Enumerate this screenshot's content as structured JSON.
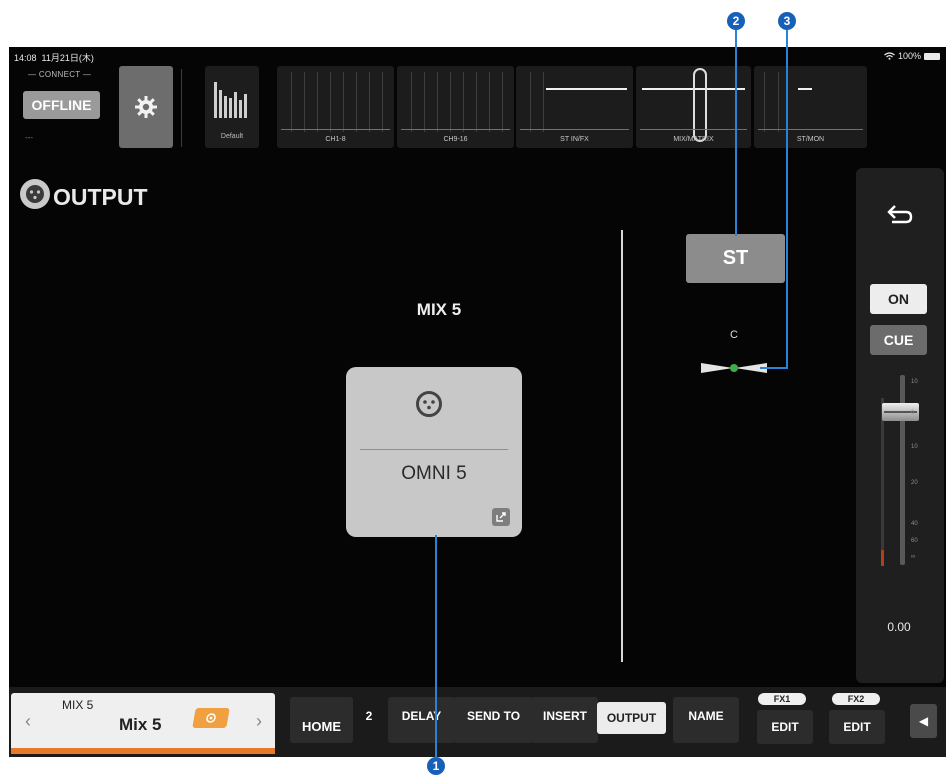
{
  "status_bar": {
    "time": "14:08",
    "date": "11月21日(木)",
    "battery": "100%"
  },
  "connect": {
    "caption": "— CONNECT —",
    "offline_label": "OFFLINE",
    "sub_text": "---"
  },
  "scene": {
    "label": "Default"
  },
  "banks": [
    {
      "label": "CH1-8"
    },
    {
      "label": "CH9-16"
    },
    {
      "label": "ST IN/FX"
    },
    {
      "label": "MIX/MATRIX"
    },
    {
      "label": "ST/MON"
    }
  ],
  "page": {
    "title": "OUTPUT",
    "mix_title": "MIX 5",
    "patch_label": "OMNI 5"
  },
  "st_button": {
    "label": "ST"
  },
  "pan": {
    "label": "C",
    "value": 0
  },
  "strip": {
    "on_label": "ON",
    "cue_label": "CUE",
    "fader_value": "0.00",
    "fader_level_db": 0,
    "scale": [
      "10",
      "0",
      "10",
      "20",
      "40",
      "60",
      "∞"
    ]
  },
  "bottom_bar": {
    "channel_top_name": "MIX 5",
    "channel_name": "Mix 5",
    "tabs": {
      "home": "HOME",
      "partial": "2",
      "delay": "DELAY",
      "send_to": "SEND TO",
      "insert": "INSERT",
      "output": "OUTPUT",
      "name": "NAME"
    },
    "fx1_tag": "FX1",
    "fx2_tag": "FX2",
    "fx1_edit": "EDIT",
    "fx2_edit": "EDIT"
  },
  "callouts": [
    "2",
    "3",
    "1"
  ],
  "colors": {
    "callout": "#1760b8",
    "accent_orange": "#e67a28",
    "pan_dot": "#3fae4a"
  }
}
